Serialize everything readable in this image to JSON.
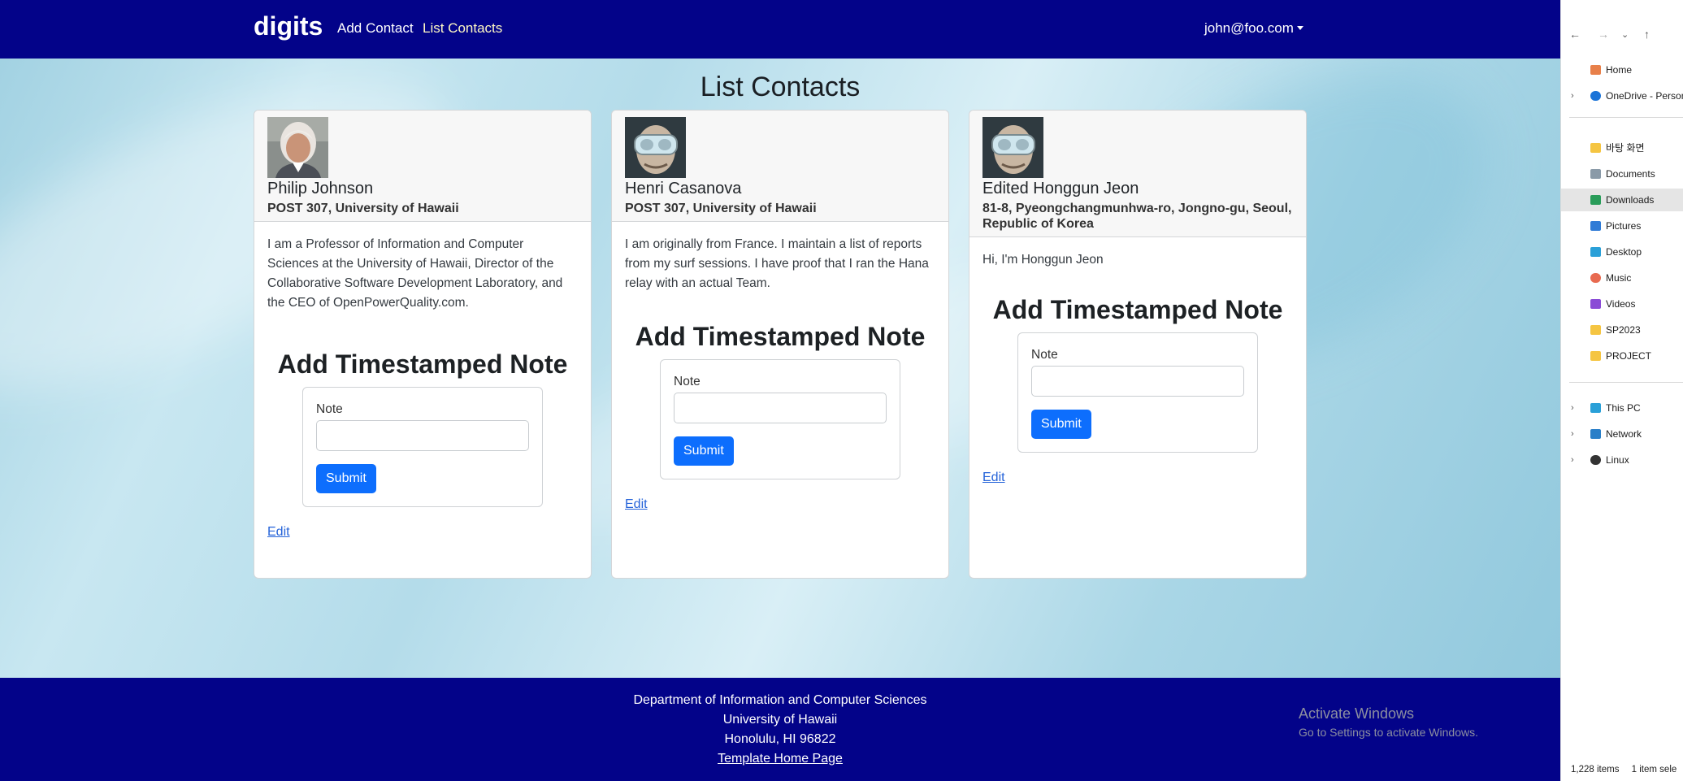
{
  "navbar": {
    "brand": "digits",
    "links": [
      {
        "label": "Add Contact",
        "active": false
      },
      {
        "label": "List Contacts",
        "active": true
      }
    ],
    "user_menu": "john@foo.com"
  },
  "page_title": "List Contacts",
  "contacts": [
    {
      "name": "Philip Johnson",
      "address": "POST 307, University of Hawaii",
      "description": "I am a Professor of Information and Computer Sciences at the University of Hawaii, Director of the Collaborative Software Development Laboratory, and the CEO of OpenPowerQuality.com.",
      "note_title": "Add Timestamped Note",
      "note_label": "Note",
      "note_value": "",
      "submit_label": "Submit",
      "edit_label": "Edit"
    },
    {
      "name": "Henri Casanova",
      "address": "POST 307, University of Hawaii",
      "description": "I am originally from France. I maintain a list of reports from my surf sessions. I have proof that I ran the Hana relay with an actual Team.",
      "note_title": "Add Timestamped Note",
      "note_label": "Note",
      "note_value": "",
      "submit_label": "Submit",
      "edit_label": "Edit"
    },
    {
      "name": "Edited Honggun Jeon",
      "address": "81-8, Pyeongchangmunhwa-ro, Jongno-gu, Seoul, Republic of Korea",
      "description": "Hi, I'm Honggun Jeon",
      "note_title": "Add Timestamped Note",
      "note_label": "Note",
      "note_value": "",
      "submit_label": "Submit",
      "edit_label": "Edit"
    }
  ],
  "footer": {
    "line1": "Department of Information and Computer Sciences",
    "line2": "University of Hawaii",
    "line3": "Honolulu, HI 96822",
    "link": "Template Home Page"
  },
  "watermark": {
    "title": "Activate Windows",
    "subtitle": "Go to Settings to activate Windows."
  },
  "explorer": {
    "items": [
      {
        "label": "Home",
        "icon": "home-icon",
        "color": "#e8804a"
      },
      {
        "label": "OneDrive - Person",
        "icon": "cloud-icon",
        "color": "#1b74d8"
      },
      {
        "label": "바탕 화면",
        "icon": "folder-icon",
        "color": "#f5c542"
      },
      {
        "label": "Documents",
        "icon": "documents-icon",
        "color": "#8a9aa8"
      },
      {
        "label": "Downloads",
        "icon": "download-icon",
        "color": "#2a9d5a"
      },
      {
        "label": "Pictures",
        "icon": "pictures-icon",
        "color": "#2f7bd6"
      },
      {
        "label": "Desktop",
        "icon": "desktop-icon",
        "color": "#2aa0d8"
      },
      {
        "label": "Music",
        "icon": "music-icon",
        "color": "#e86a50"
      },
      {
        "label": "Videos",
        "icon": "videos-icon",
        "color": "#8a4bd6"
      },
      {
        "label": "SP2023",
        "icon": "folder-icon",
        "color": "#f5c542"
      },
      {
        "label": "PROJECT",
        "icon": "folder-icon",
        "color": "#f5c542"
      },
      {
        "label": "This PC",
        "icon": "pc-icon",
        "color": "#2aa0d8"
      },
      {
        "label": "Network",
        "icon": "network-icon",
        "color": "#2a7fc8"
      },
      {
        "label": "Linux",
        "icon": "linux-icon",
        "color": "#333333"
      }
    ],
    "selected": "Downloads",
    "status_items": "1,228 items",
    "status_selected": "1 item sele"
  }
}
